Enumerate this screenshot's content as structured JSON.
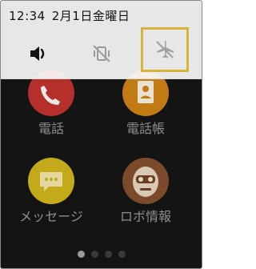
{
  "status_bar": {
    "time": "12:34",
    "date": "2月1日金曜日"
  },
  "quick_settings": {
    "items": [
      {
        "icon": "volume-icon",
        "state": "on"
      },
      {
        "icon": "vibrate-off-icon",
        "state": "off"
      },
      {
        "icon": "airplane-mode-off-icon",
        "state": "selected"
      }
    ]
  },
  "apps": [
    {
      "label": "電話",
      "icon": "phone-icon",
      "color": "#b5302b"
    },
    {
      "label": "電話帳",
      "icon": "contacts-icon",
      "color": "#c27a14"
    },
    {
      "label": "メッセージ",
      "icon": "message-icon",
      "color": "#c4a91a"
    },
    {
      "label": "ロボ情報",
      "icon": "robot-info-icon",
      "color": "#7a4a2a"
    }
  ],
  "pager": {
    "pages": 4,
    "current": 1
  },
  "colors": {
    "highlight": "#d8b23a"
  }
}
